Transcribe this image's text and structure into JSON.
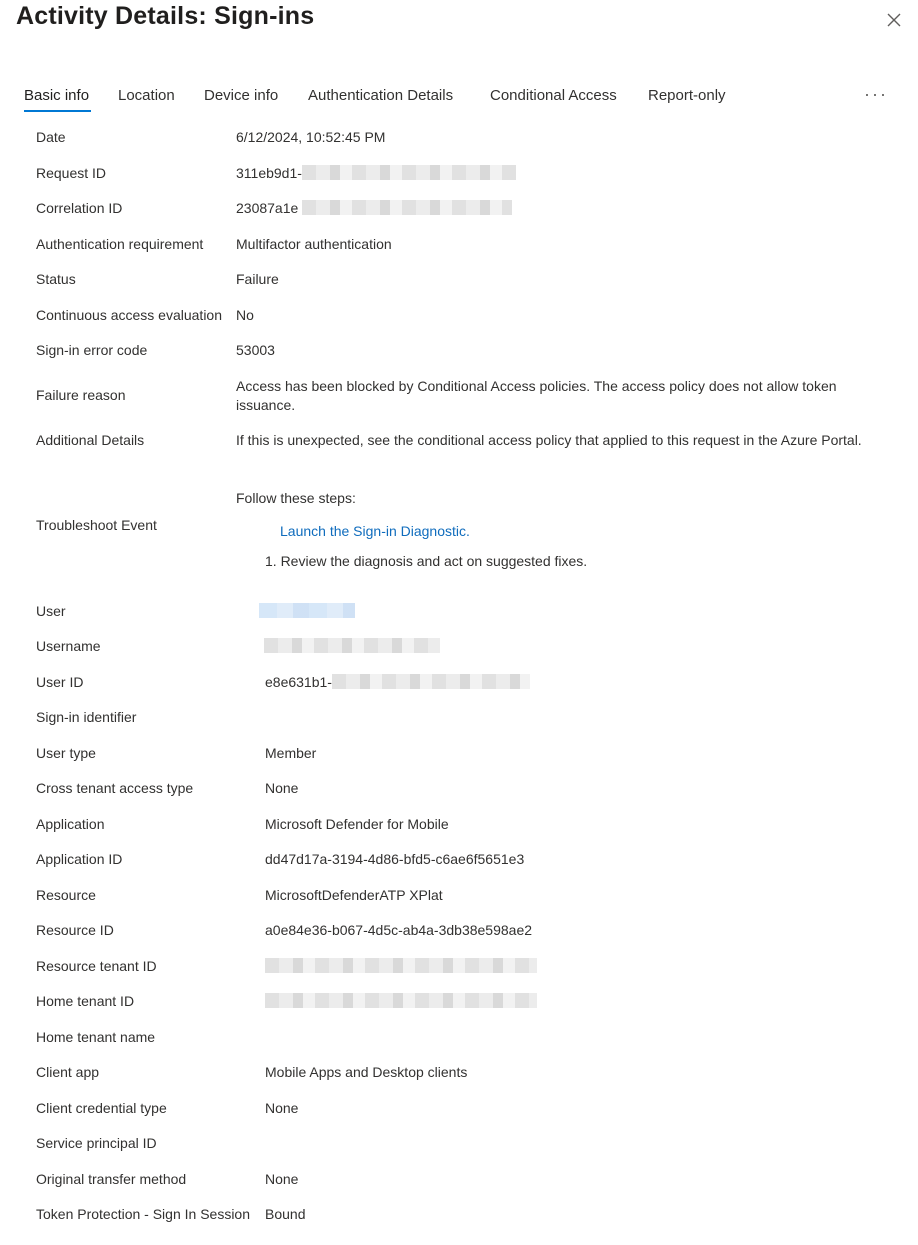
{
  "header": {
    "title": "Activity Details: Sign-ins"
  },
  "tabs": [
    {
      "label": "Basic info",
      "active": true
    },
    {
      "label": "Location"
    },
    {
      "label": "Device info"
    },
    {
      "label": "Authentication Details"
    },
    {
      "label": "Conditional Access"
    },
    {
      "label": "Report-only"
    }
  ],
  "more_label": "···",
  "details": {
    "date": {
      "label": "Date",
      "value": "6/12/2024, 10:52:45 PM"
    },
    "request_id": {
      "label": "Request ID",
      "value": "311eb9d1-"
    },
    "correlation_id": {
      "label": "Correlation ID",
      "value": "23087a1e"
    },
    "auth_requirement": {
      "label": "Authentication requirement",
      "value": "Multifactor authentication"
    },
    "status": {
      "label": "Status",
      "value": "Failure"
    },
    "continuous_access": {
      "label": "Continuous access evaluation",
      "value": "No"
    },
    "error_code": {
      "label": "Sign-in error code",
      "value": "53003"
    },
    "failure_reason": {
      "label": "Failure reason",
      "value": "Access has been blocked by Conditional Access policies. The access policy does not allow token issuance."
    },
    "additional_details": {
      "label": "Additional Details",
      "value": "If this is unexpected, see the conditional access policy that applied to this request in the Azure Portal."
    },
    "troubleshoot": {
      "label": "Troubleshoot Event",
      "intro": "Follow these steps:",
      "link": "Launch the Sign-in Diagnostic.",
      "step1": "1. Review the diagnosis and act on suggested fixes."
    },
    "user": {
      "label": "User"
    },
    "username": {
      "label": "Username"
    },
    "user_id": {
      "label": "User ID",
      "value": "e8e631b1-"
    },
    "signin_identifier": {
      "label": "Sign-in identifier"
    },
    "user_type": {
      "label": "User type",
      "value": "Member"
    },
    "cross_tenant": {
      "label": "Cross tenant access type",
      "value": "None"
    },
    "application": {
      "label": "Application",
      "value": "Microsoft Defender for Mobile"
    },
    "application_id": {
      "label": "Application ID",
      "value": "dd47d17a-3194-4d86-bfd5-c6ae6f5651e3"
    },
    "resource": {
      "label": "Resource",
      "value": "MicrosoftDefenderATP XPlat"
    },
    "resource_id": {
      "label": "Resource ID",
      "value": "a0e84e36-b067-4d5c-ab4a-3db38e598ae2"
    },
    "resource_tenant_id": {
      "label": "Resource tenant ID"
    },
    "home_tenant_id": {
      "label": "Home tenant ID"
    },
    "home_tenant_name": {
      "label": "Home tenant name"
    },
    "client_app": {
      "label": "Client app",
      "value": "Mobile Apps and Desktop clients"
    },
    "client_credential_type": {
      "label": "Client credential type",
      "value": "None"
    },
    "service_principal_id": {
      "label": "Service principal ID"
    },
    "original_transfer": {
      "label": "Original transfer method",
      "value": "None"
    },
    "token_protection": {
      "label": "Token Protection - Sign In Session",
      "value": "Bound"
    }
  }
}
